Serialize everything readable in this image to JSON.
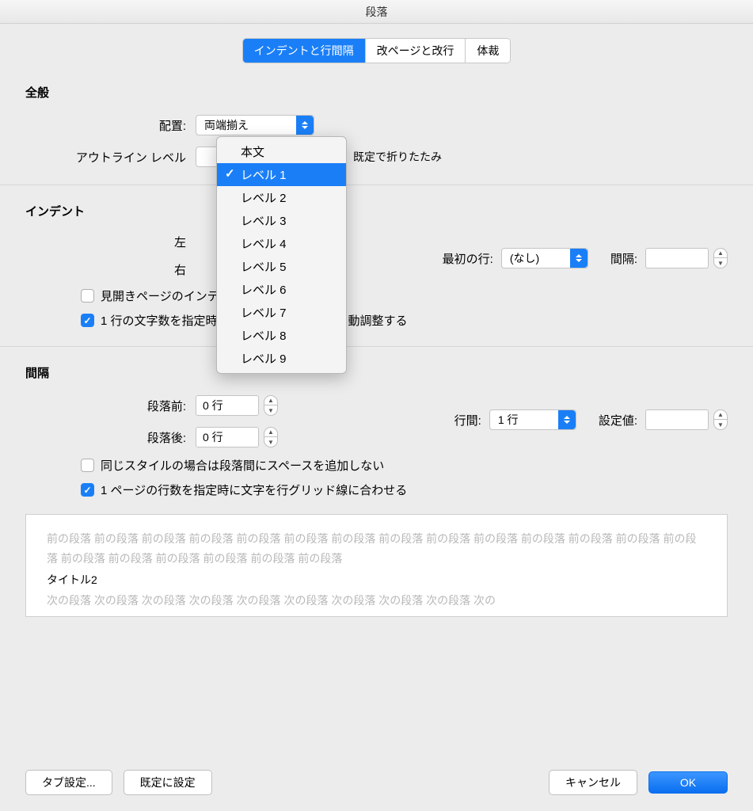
{
  "title": "段落",
  "tabs": {
    "indent": "インデントと行間隔",
    "page": "改ページと改行",
    "layout": "体裁"
  },
  "general": {
    "heading": "全般",
    "align_label": "配置:",
    "align_value": "両端揃え",
    "outline_label": "アウトライン レベル",
    "collapse_label": "既定で折りたたみ"
  },
  "dropdown": {
    "items": [
      "本文",
      "レベル 1",
      "レベル 2",
      "レベル 3",
      "レベル 4",
      "レベル 5",
      "レベル 6",
      "レベル 7",
      "レベル 8",
      "レベル 9"
    ]
  },
  "indent": {
    "heading": "インデント",
    "left_label": "左",
    "right_label": "右",
    "first_line_label": "最初の行:",
    "first_line_value": "(なし)",
    "width_label": "間隔:",
    "mirror_label": "見開きページのインデント幅を設定する",
    "auto_label": "1 行の文字数を指定時に右のインデント幅を自動調整する"
  },
  "spacing": {
    "heading": "間隔",
    "before_label": "段落前:",
    "before_value": "0 行",
    "after_label": "段落後:",
    "after_value": "0 行",
    "line_label": "行間:",
    "line_value": "1 行",
    "at_label": "設定値:",
    "nospace_label": "同じスタイルの場合は段落間にスペースを追加しない",
    "snap_label": "1 ページの行数を指定時に文字を行グリッド線に合わせる"
  },
  "preview": {
    "prev": "前の段落 前の段落 前の段落 前の段落 前の段落 前の段落 前の段落 前の段落 前の段落 前の段落 前の段落 前の段落 前の段落 前の段落 前の段落 前の段落 前の段落 前の段落 前の段落 前の段落",
    "current": "タイトル2",
    "next": "次の段落 次の段落 次の段落 次の段落 次の段落 次の段落 次の段落 次の段落 次の段落 次の"
  },
  "footer": {
    "tabs": "タブ設定...",
    "default": "既定に設定",
    "cancel": "キャンセル",
    "ok": "OK"
  }
}
